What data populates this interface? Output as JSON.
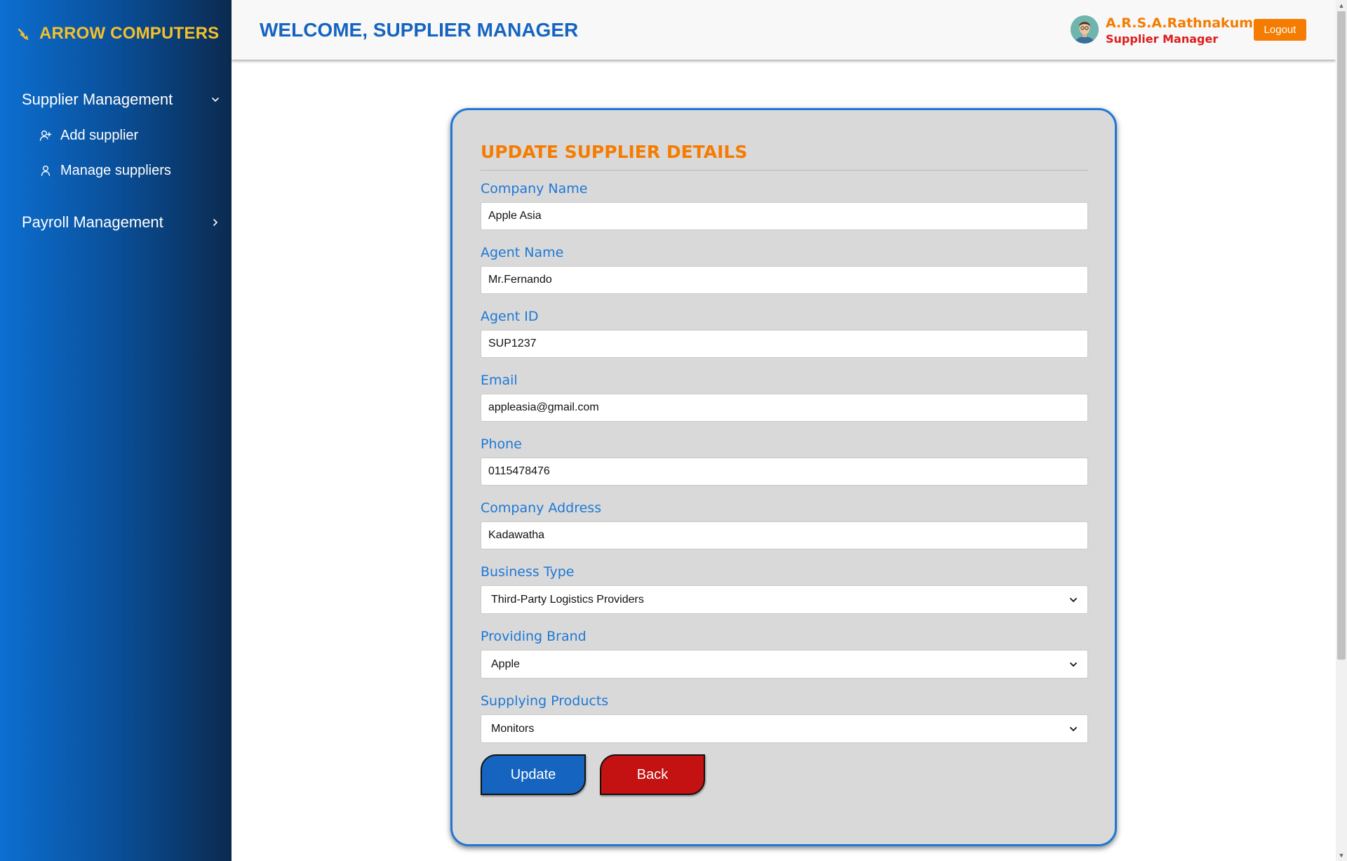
{
  "sidebar": {
    "brand": "ARROW COMPUTERS",
    "groups": [
      {
        "label": "Supplier Management",
        "expanded": true,
        "items": [
          {
            "label": "Add supplier",
            "icon": "user-plus-icon"
          },
          {
            "label": "Manage suppliers",
            "icon": "user-icon"
          }
        ]
      },
      {
        "label": "Payroll Management",
        "expanded": false,
        "items": []
      }
    ]
  },
  "header": {
    "welcome": "WELCOME, SUPPLIER MANAGER",
    "user_name": "A.R.S.A.Rathnakumara",
    "user_role": "Supplier Manager",
    "logout_label": "Logout"
  },
  "form": {
    "title": "UPDATE SUPPLIER DETAILS",
    "fields": {
      "company_name": {
        "label": "Company Name",
        "value": "Apple Asia"
      },
      "agent_name": {
        "label": "Agent Name",
        "value": "Mr.Fernando"
      },
      "agent_id": {
        "label": "Agent ID",
        "value": "SUP1237"
      },
      "email": {
        "label": "Email",
        "value": "appleasia@gmail.com"
      },
      "phone": {
        "label": "Phone",
        "value": "0115478476"
      },
      "company_address": {
        "label": "Company Address",
        "value": "Kadawatha"
      },
      "business_type": {
        "label": "Business Type",
        "value": "Third-Party Logistics Providers"
      },
      "providing_brand": {
        "label": "Providing Brand",
        "value": "Apple"
      },
      "supplying_products": {
        "label": "Supplying Products",
        "value": "Monitors"
      }
    },
    "update_label": "Update",
    "back_label": "Back"
  },
  "colors": {
    "accent_blue": "#1565c0",
    "accent_orange": "#f57c00",
    "brand_yellow": "#f4c02c",
    "danger_red": "#c41111"
  }
}
